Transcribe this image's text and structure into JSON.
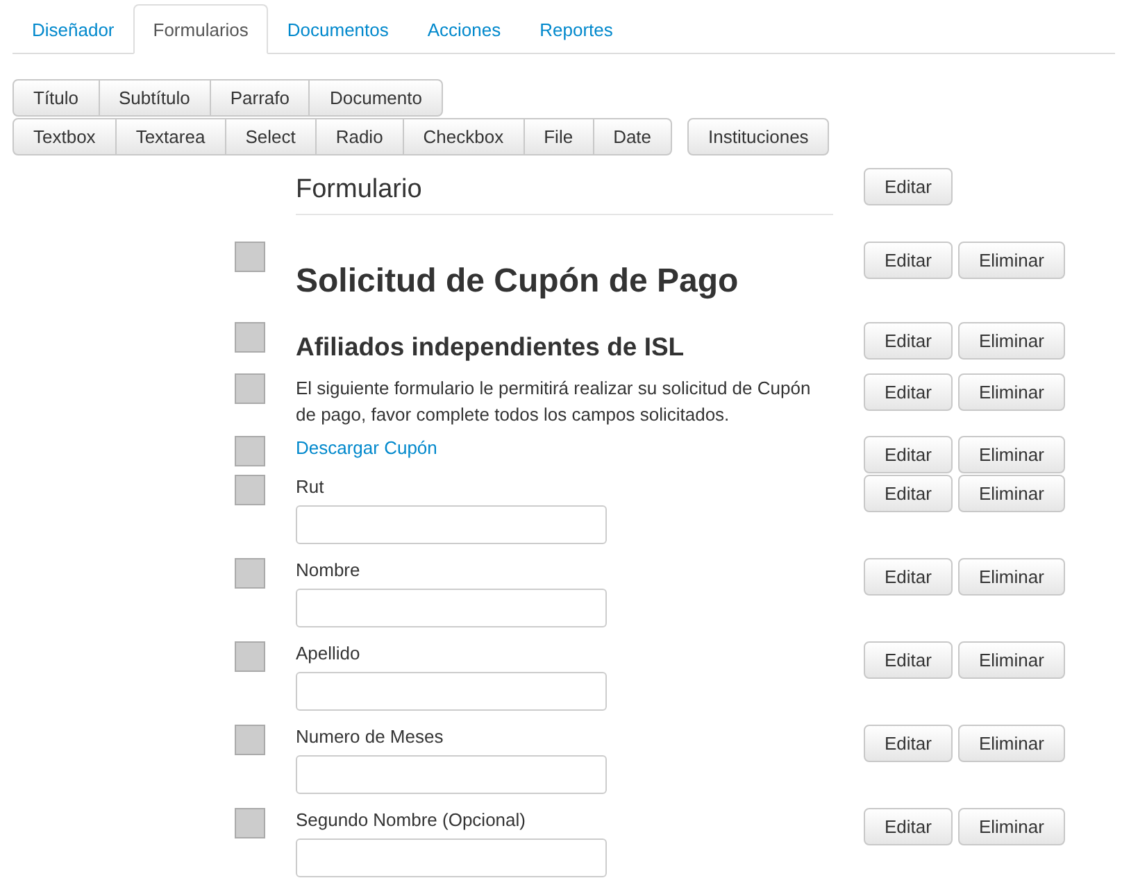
{
  "tabs": [
    {
      "label": "Diseñador",
      "selected": false
    },
    {
      "label": "Formularios",
      "selected": true
    },
    {
      "label": "Documentos",
      "selected": false
    },
    {
      "label": "Acciones",
      "selected": false
    },
    {
      "label": "Reportes",
      "selected": false
    }
  ],
  "toolbar_groups": [
    [
      "Título",
      "Subtítulo",
      "Parrafo",
      "Documento"
    ],
    [
      "Textbox",
      "Textarea",
      "Select",
      "Radio",
      "Checkbox",
      "File",
      "Date"
    ],
    [
      "Instituciones"
    ]
  ],
  "form": {
    "heading": "Formulario",
    "edit_label": "Editar"
  },
  "elements": [
    {
      "kind": "title",
      "text": "Solicitud de Cupón de Pago",
      "edit_label": "Editar",
      "delete_label": "Eliminar"
    },
    {
      "kind": "subtitle",
      "text": "Afiliados independientes de ISL",
      "edit_label": "Editar",
      "delete_label": "Eliminar"
    },
    {
      "kind": "paragraph",
      "text": "El siguiente formulario le permitirá realizar su solicitud de Cupón de pago, favor complete todos los campos solicitados.",
      "edit_label": "Editar",
      "delete_label": "Eliminar"
    },
    {
      "kind": "link",
      "text": "Descargar Cupón",
      "edit_label": "Editar",
      "delete_label": "Eliminar"
    },
    {
      "kind": "textbox",
      "text": "Rut",
      "edit_label": "Editar",
      "delete_label": "Eliminar"
    },
    {
      "kind": "textbox",
      "text": "Nombre",
      "edit_label": "Editar",
      "delete_label": "Eliminar"
    },
    {
      "kind": "textbox",
      "text": "Apellido",
      "edit_label": "Editar",
      "delete_label": "Eliminar"
    },
    {
      "kind": "textbox",
      "text": "Numero de Meses",
      "edit_label": "Editar",
      "delete_label": "Eliminar"
    },
    {
      "kind": "textbox",
      "text": "Segundo Nombre (Opcional)",
      "edit_label": "Editar",
      "delete_label": "Eliminar"
    }
  ]
}
